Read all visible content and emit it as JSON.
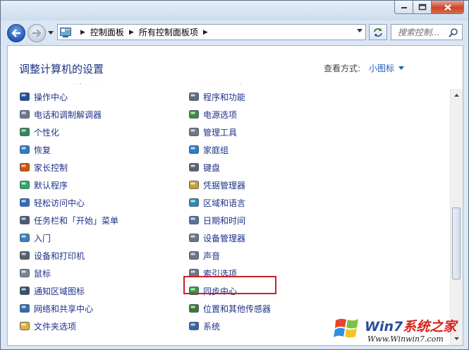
{
  "address": {
    "crumbs": [
      "控制面板",
      "所有控制面板项"
    ]
  },
  "search": {
    "placeholder": "搜索控制..."
  },
  "header": {
    "title": "调整计算机的设置",
    "view_by_label": "查看方式:",
    "view_by_value": "小图标"
  },
  "left_items": [
    {
      "label": "Windows 防火墙",
      "icon": "firewall-icon",
      "color": "#c0392b"
    },
    {
      "label": "操作中心",
      "icon": "flag-icon",
      "color": "#1f4fa0"
    },
    {
      "label": "电话和调制解调器",
      "icon": "phone-modem-icon",
      "color": "#6b7a8c"
    },
    {
      "label": "个性化",
      "icon": "personalization-icon",
      "color": "#2e8b57"
    },
    {
      "label": "恢复",
      "icon": "recovery-icon",
      "color": "#2f7bc4"
    },
    {
      "label": "家长控制",
      "icon": "parental-control-icon",
      "color": "#d35400"
    },
    {
      "label": "默认程序",
      "icon": "default-programs-icon",
      "color": "#27ae60"
    },
    {
      "label": "轻松访问中心",
      "icon": "ease-of-access-icon",
      "color": "#2a6dc8"
    },
    {
      "label": "任务栏和「开始」菜单",
      "icon": "taskbar-icon",
      "color": "#4a5b70"
    },
    {
      "label": "入门",
      "icon": "getting-started-icon",
      "color": "#3a7fc1"
    },
    {
      "label": "设备和打印机",
      "icon": "printer-icon",
      "color": "#555f6e"
    },
    {
      "label": "鼠标",
      "icon": "mouse-icon",
      "color": "#7a8593"
    },
    {
      "label": "通知区域图标",
      "icon": "notification-area-icon",
      "color": "#3a4f6b"
    },
    {
      "label": "网络和共享中心",
      "icon": "network-icon",
      "color": "#2d6fb5"
    },
    {
      "label": "文件夹选项",
      "icon": "folder-icon",
      "color": "#e2b13c"
    }
  ],
  "right_items": [
    {
      "label": "备份和还原",
      "icon": "backup-icon",
      "color": "#6f7f3a"
    },
    {
      "label": "程序和功能",
      "icon": "programs-icon",
      "color": "#5d6d80"
    },
    {
      "label": "电源选项",
      "icon": "power-icon",
      "color": "#3d8b3d"
    },
    {
      "label": "管理工具",
      "icon": "admin-tools-icon",
      "color": "#6a7786"
    },
    {
      "label": "家庭组",
      "icon": "homegroup-icon",
      "color": "#2b7cc9"
    },
    {
      "label": "键盘",
      "icon": "keyboard-icon",
      "color": "#5c6470"
    },
    {
      "label": "凭据管理器",
      "icon": "credential-icon",
      "color": "#c9a22b"
    },
    {
      "label": "区域和语言",
      "icon": "region-icon",
      "color": "#2a8bb5"
    },
    {
      "label": "日期和时间",
      "icon": "clock-icon",
      "color": "#5b7595"
    },
    {
      "label": "设备管理器",
      "icon": "device-manager-icon",
      "color": "#6d7784"
    },
    {
      "label": "声音",
      "icon": "sound-icon",
      "color": "#6d7784"
    },
    {
      "label": "索引选项",
      "icon": "indexing-icon",
      "color": "#6d7784"
    },
    {
      "label": "同步中心",
      "icon": "sync-icon",
      "color": "#2f9b43"
    },
    {
      "label": "位置和其他传感器",
      "icon": "sensor-icon",
      "color": "#3b7a2f"
    },
    {
      "label": "系统",
      "icon": "system-icon",
      "color": "#3766a6"
    }
  ],
  "highlighted_item": "索引选项",
  "watermark": {
    "title_blue": "Win7",
    "title_red": "系统之家",
    "url": "Www.Winwin7.com"
  }
}
